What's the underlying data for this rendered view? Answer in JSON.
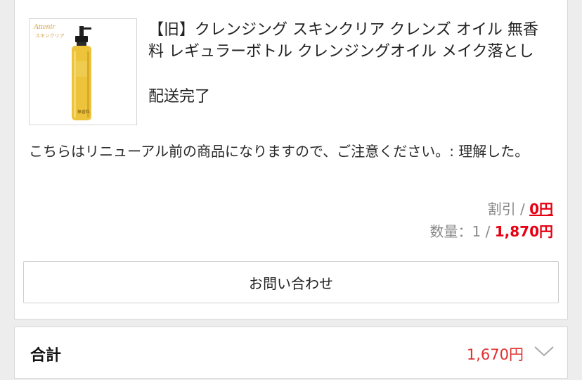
{
  "order_item": {
    "product_image_alt": "Attenir cleansing oil bottle",
    "image_brand_text": "Attenir",
    "image_sub_text": "スキンクリア",
    "image_label_text": "無香料",
    "title": "【旧】クレンジング スキンクリア クレンズ オイル 無香料 レギュラーボトル クレンジングオイル メイク落とし",
    "status": "配送完了",
    "notice": "こちらはリニューアル前の商品になりますので、ご注意ください。: 理解した。",
    "discount_label": "割引 / ",
    "discount_value": "0円",
    "quantity_label": "数量：1 / ",
    "price": "1,870円",
    "inquiry_button": "お問い合わせ"
  },
  "summary": {
    "total_label": "合計",
    "total_amount": "1,670円"
  },
  "colors": {
    "accent_red": "#e60012",
    "total_red": "#e03030",
    "muted_gray": "#888888",
    "background": "#ededed"
  },
  "icons": {
    "expand": "chevron-down-icon"
  }
}
